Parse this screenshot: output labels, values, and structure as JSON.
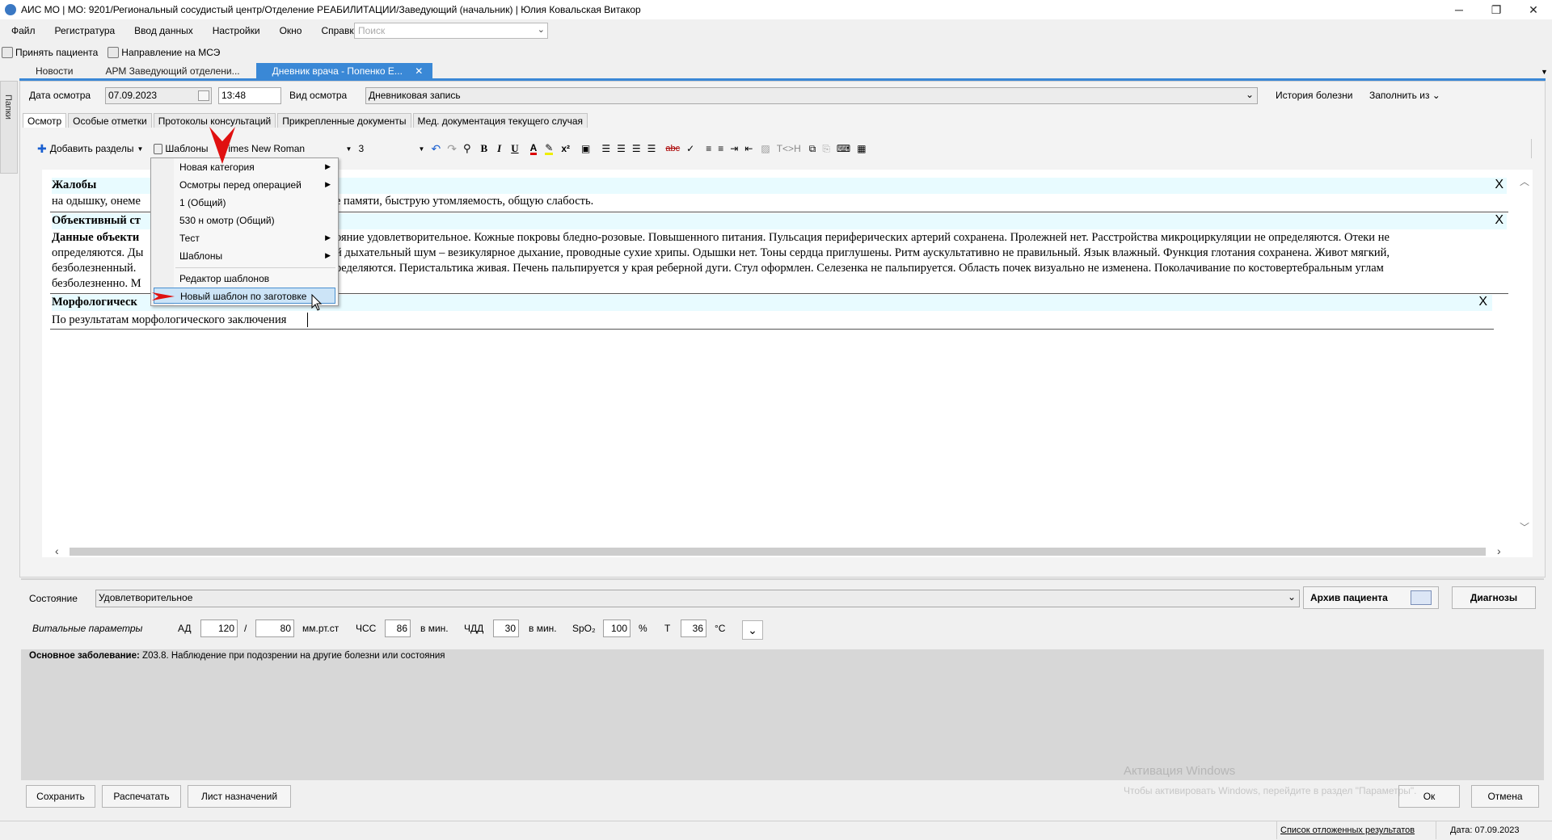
{
  "window": {
    "title": "АИС МО | МО: 9201/Региональный сосудистый центр/Отделение РЕАБИЛИТАЦИИ/Заведующий (начальник) | Юлия Ковальская Витакор",
    "controls": [
      "─",
      "❐",
      "✕"
    ]
  },
  "menu": [
    "Файл",
    "Регистратура",
    "Ввод данных",
    "Настройки",
    "Окно",
    "Справка"
  ],
  "search": {
    "placeholder": "Поиск"
  },
  "toolbar": {
    "accept_patient": "Принять пациента",
    "mse_referral": "Направление на МСЭ"
  },
  "tabs": [
    {
      "label": "Новости"
    },
    {
      "label": "АРМ Заведующий отделени..."
    },
    {
      "label": "Дневник врача - Попенко Е...",
      "close": "✕"
    }
  ],
  "side_tab": "Папки",
  "exam": {
    "date_label": "Дата осмотра",
    "date_value": "07.09.2023",
    "time_value": "13:48",
    "type_label": "Вид осмотра",
    "type_value": "Дневниковая  запись",
    "history_link": "История болезни",
    "fill_from": "Заполнить из"
  },
  "subtabs": [
    "Осмотр",
    "Особые отметки",
    "Протоколы консультаций",
    "Прикрепленные документы",
    "Мед. документация текущего случая"
  ],
  "editor_toolbar": {
    "add_sections": "Добавить разделы",
    "templates": "Шаблоны",
    "font": "Times New Roman",
    "size": "3",
    "find_replace": "T<>H"
  },
  "context_menu": {
    "items": [
      {
        "label": "Новая категория",
        "submenu": true
      },
      {
        "label": "Осмотры перед операцией",
        "submenu": true
      },
      {
        "label": "1 (Общий)",
        "submenu": false
      },
      {
        "label": "530 н омотр (Общий)",
        "submenu": false
      },
      {
        "label": "Тест",
        "submenu": true
      },
      {
        "label": "Шаблоны",
        "submenu": true
      },
      {
        "label": "Редактор шаблонов",
        "submenu": false
      },
      {
        "label": "Новый шаблон по заготовке",
        "submenu": false,
        "selected": true
      }
    ]
  },
  "document": {
    "close_x": "X",
    "sec1_title": "Жалобы",
    "sec1_line1a": "на одышку, онеме",
    "sec1_line1b": "е памяти, быструю утомляемость, общую слабость.",
    "sec2_title": "Объективный ст",
    "sec2_sub": "Данные объекти",
    "sec2_l1": "ояние удовлетворительное. Кожные покровы бледно-розовые. Повышенного питания. Пульсация периферических артерий сохранена. Пролежней нет. Расстройства микроциркуляции не определяются. Отеки не",
    "sec2_l2a": "определяются. Ды",
    "sec2_l2b": "й дыхательный шум – везикулярное дыхание, проводные сухие хрипы. Одышки нет. Тоны сердца приглушены. Ритм аускультативно не правильный. Язык влажный. Функция глотания сохранена. Живот мягкий,",
    "sec2_l3a": "безболезненный.",
    "sec2_l3b": "ределяются. Перистальтика живая. Печень пальпируется у края реберной дуги. Стул оформлен. Селезенка не пальпируется. Область почек визуально не изменена. Поколачивание по костовертебральным углам",
    "sec2_l4": "безболезненно. М",
    "sec3_title": "Морфологическ",
    "sec3_body": "По результатам морфологического заключения"
  },
  "bottom": {
    "state_label": "Состояние",
    "state_value": "Удовлетворительное",
    "archive_btn": "Архив пациента",
    "diagnoses_btn": "Диагнозы",
    "vitals_label": "Витальные параметры",
    "ad_label": "АД",
    "ad_sys": "120",
    "slash": "/",
    "ad_dia": "80",
    "ad_unit": "мм.рт.ст",
    "hr_label": "ЧСС",
    "hr_value": "86",
    "hr_unit": "в мин.",
    "rr_label": "ЧДД",
    "rr_value": "30",
    "rr_unit": "в мин.",
    "spo2_label": "SpO₂",
    "spo2_value": "100",
    "spo2_unit": "%",
    "t_label": "Т",
    "t_value": "36",
    "t_unit": "°С",
    "diag_bold": "Основное заболевание:",
    "diag_text": " Z03.8. Наблюдение при подозрении на другие болезни или состояния"
  },
  "footer_buttons": {
    "save": "Сохранить",
    "print": "Распечатать",
    "assignments": "Лист назначений",
    "ok": "Ок",
    "cancel": "Отмена"
  },
  "toast": {
    "title": "Активация Windows",
    "text": "Чтобы активировать Windows, перейдите в раздел \"Параметры\"."
  },
  "status": {
    "deferred": "Список отложенных результатов",
    "date": "Дата: 07.09.2023"
  }
}
